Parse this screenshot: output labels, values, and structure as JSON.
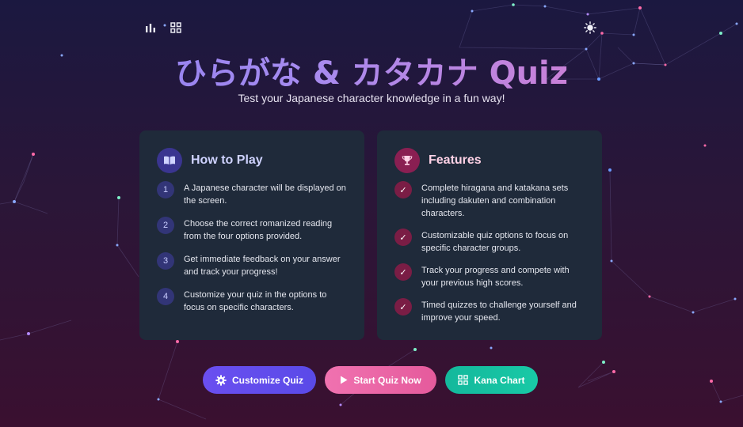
{
  "header": {
    "title": "ひらがな & カタカナ Quiz",
    "subtitle": "Test your Japanese character knowledge in a fun way!",
    "icons": [
      "stats-icon",
      "grid-icon",
      "sun-icon"
    ]
  },
  "how_to_play": {
    "title": "How to Play",
    "icon": "book-icon",
    "steps": [
      {
        "num": "1",
        "text": "A Japanese character will be displayed on the screen."
      },
      {
        "num": "2",
        "text": "Choose the correct romanized reading from the four options provided."
      },
      {
        "num": "3",
        "text": "Get immediate feedback on your answer and track your progress!"
      },
      {
        "num": "4",
        "text": "Customize your quiz in the options to focus on specific characters."
      }
    ]
  },
  "features": {
    "title": "Features",
    "icon": "trophy-icon",
    "items": [
      {
        "mark": "✓",
        "text": "Complete hiragana and katakana sets including dakuten and combination characters."
      },
      {
        "mark": "✓",
        "text": "Customizable quiz options to focus on specific character groups."
      },
      {
        "mark": "✓",
        "text": "Track your progress and compete with your previous high scores."
      },
      {
        "mark": "✓",
        "text": "Timed quizzes to challenge yourself and improve your speed."
      }
    ]
  },
  "actions": {
    "customize_label": "Customize Quiz",
    "start_label": "Start Quiz Now",
    "chart_label": "Kana Chart"
  },
  "colors": {
    "accent_purple": "#6a4ff0",
    "accent_pink": "#e55a9c",
    "accent_teal": "#18c9a6",
    "card_bg": "#1f2a3a"
  }
}
